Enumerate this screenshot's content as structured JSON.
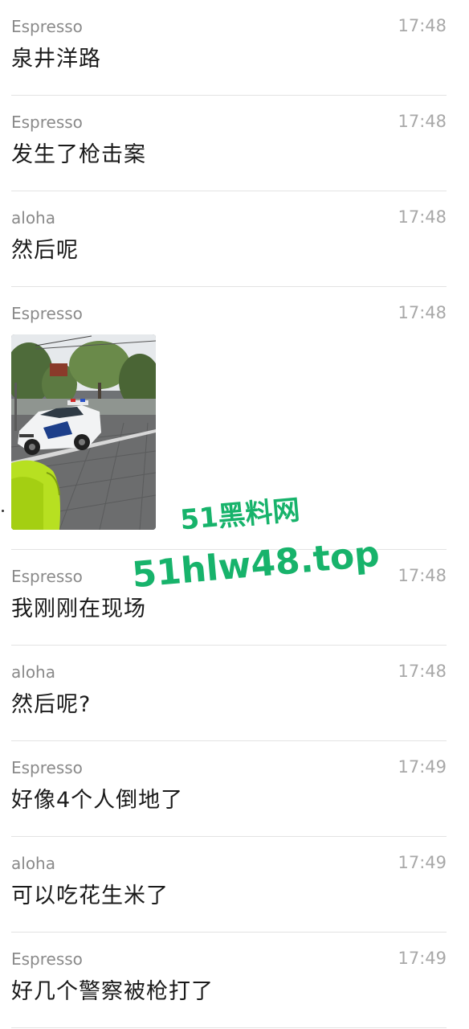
{
  "messages": [
    {
      "sender": "Espresso",
      "time": "17:48",
      "text": "泉井洋路"
    },
    {
      "sender": "Espresso",
      "time": "17:48",
      "text": "发生了枪击案"
    },
    {
      "sender": "aloha",
      "time": "17:48",
      "text": "然后呢"
    },
    {
      "sender": "Espresso",
      "time": "17:48",
      "image": "police-car-photo"
    },
    {
      "sender": "Espresso",
      "time": "17:48",
      "text": "我刚刚在现场"
    },
    {
      "sender": "aloha",
      "time": "17:48",
      "text": "然后呢?"
    },
    {
      "sender": "Espresso",
      "time": "17:49",
      "text": "好像4个人倒地了"
    },
    {
      "sender": "aloha",
      "time": "17:49",
      "text": "可以吃花生米了"
    },
    {
      "sender": "Espresso",
      "time": "17:49",
      "text": "好几个警察被枪打了"
    }
  ],
  "watermark": {
    "line1": "51黑料网",
    "line2": "51hlw48.top",
    "color": "#17b36b"
  },
  "colors": {
    "sender": "#8a8a8a",
    "time": "#a8a8a8",
    "text": "#1a1a1a",
    "divider": "#e3e3e3"
  }
}
